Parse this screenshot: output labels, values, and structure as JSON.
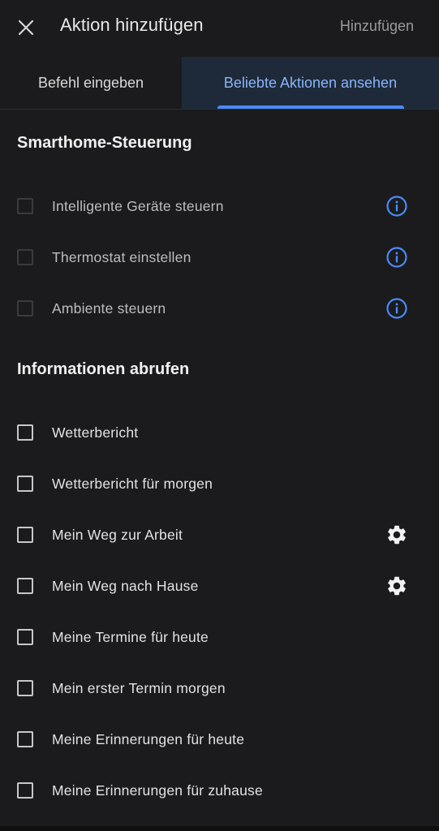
{
  "header": {
    "close_icon": "close-icon",
    "title": "Aktion hinzufügen",
    "add_label": "Hinzufügen"
  },
  "tabs": [
    {
      "label": "Befehl eingeben",
      "active": false
    },
    {
      "label": "Beliebte Aktionen ansehen",
      "active": true
    }
  ],
  "colors": {
    "background": "#1b1b1d",
    "accent": "#4a8af4",
    "active_tab_text": "#8ab4f8",
    "active_tab_bg": "#1e2a3a",
    "info_icon": "#4a8af4"
  },
  "sections": [
    {
      "title": "Smarthome-Steuerung",
      "items": [
        {
          "label": "Intelligente Geräte steuern",
          "checked": false,
          "disabled": true,
          "trailing_icon": "info-icon"
        },
        {
          "label": "Thermostat einstellen",
          "checked": false,
          "disabled": true,
          "trailing_icon": "info-icon"
        },
        {
          "label": "Ambiente steuern",
          "checked": false,
          "disabled": true,
          "trailing_icon": "info-icon"
        }
      ]
    },
    {
      "title": "Informationen abrufen",
      "items": [
        {
          "label": "Wetterbericht",
          "checked": false,
          "disabled": false,
          "trailing_icon": ""
        },
        {
          "label": "Wetterbericht für morgen",
          "checked": false,
          "disabled": false,
          "trailing_icon": ""
        },
        {
          "label": "Mein Weg zur Arbeit",
          "checked": false,
          "disabled": false,
          "trailing_icon": "gear-icon"
        },
        {
          "label": "Mein Weg nach Hause",
          "checked": false,
          "disabled": false,
          "trailing_icon": "gear-icon"
        },
        {
          "label": "Meine Termine für heute",
          "checked": false,
          "disabled": false,
          "trailing_icon": ""
        },
        {
          "label": "Mein erster Termin morgen",
          "checked": false,
          "disabled": false,
          "trailing_icon": ""
        },
        {
          "label": "Meine Erinnerungen für heute",
          "checked": false,
          "disabled": false,
          "trailing_icon": ""
        },
        {
          "label": "Meine Erinnerungen für zuhause",
          "checked": false,
          "disabled": false,
          "trailing_icon": ""
        }
      ]
    }
  ]
}
